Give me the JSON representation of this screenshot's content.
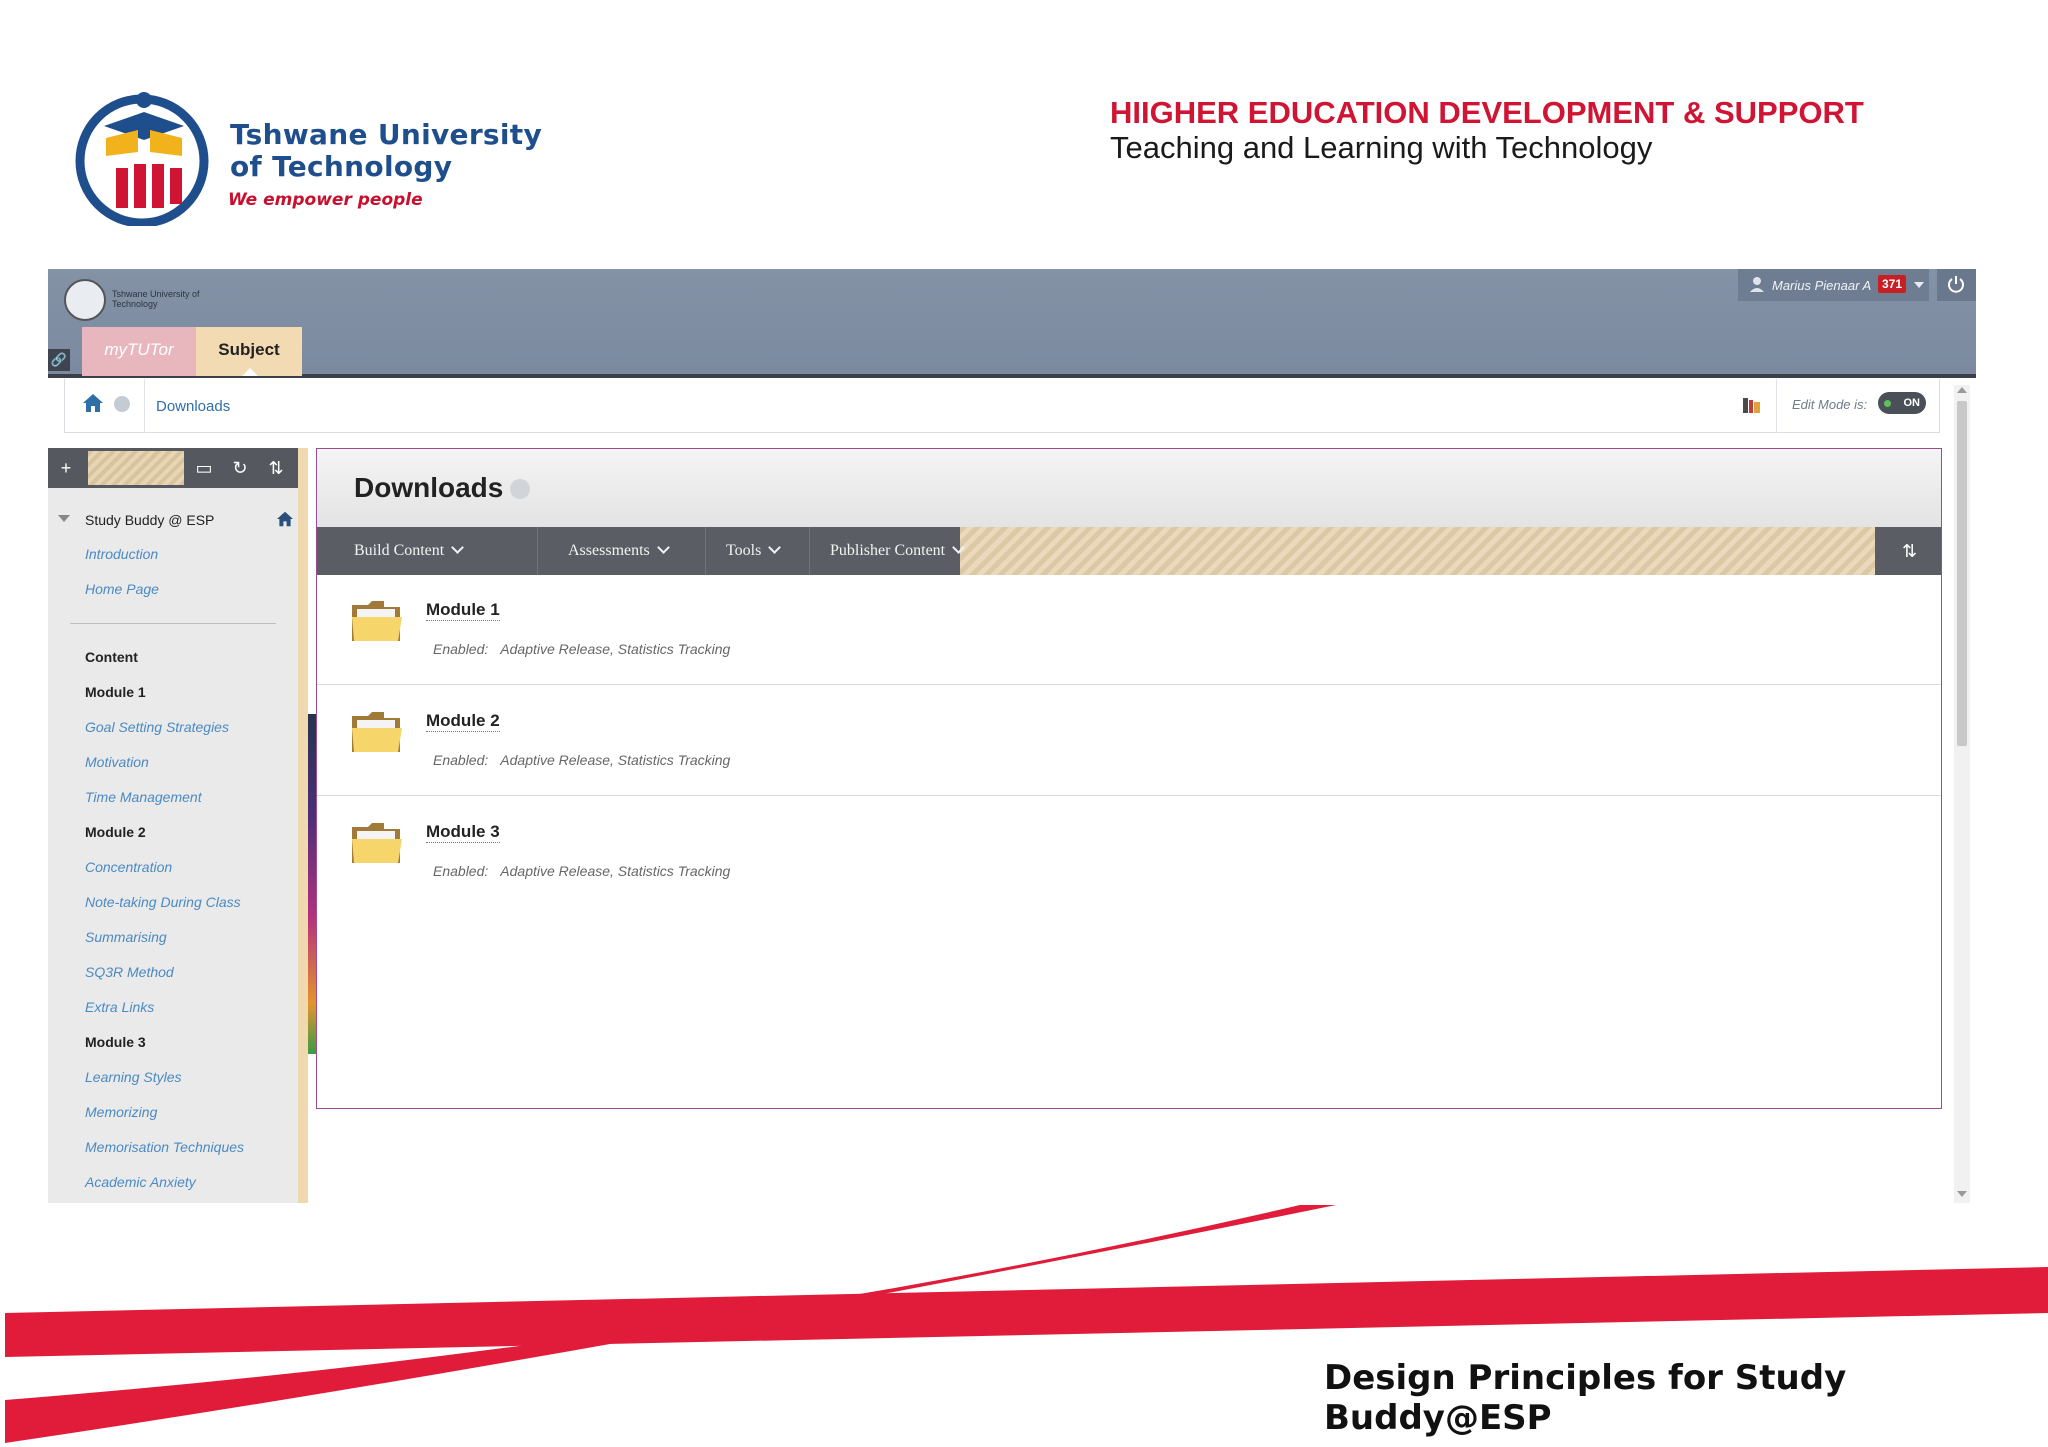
{
  "slide": {
    "university_name_line1": "Tshwane University",
    "university_name_line2": "of Technology",
    "tagline": "We empower people",
    "header_title": "HIIGHER EDUCATION DEVELOPMENT & SUPPORT",
    "header_subtitle": "Teaching and Learning with Technology",
    "footer_title": "Design Principles for Study Buddy@ESP",
    "colors": {
      "brand_red": "#d01433",
      "brand_blue": "#1f4e8c"
    }
  },
  "topbar": {
    "mini_logo_text": "Tshwane University of Technology",
    "tabs": [
      {
        "label": "myTUTor"
      },
      {
        "label": "Subject"
      }
    ],
    "user_name": "Marius Pienaar A",
    "notification_count": "371"
  },
  "breadcrumb": {
    "current": "Downloads",
    "edit_mode_label": "Edit Mode is:",
    "edit_mode_value": "ON"
  },
  "course_menu": {
    "course_title": "Study Buddy @ ESP",
    "items": [
      {
        "label": "Introduction",
        "kind": "link"
      },
      {
        "label": "Home Page",
        "kind": "link"
      },
      {
        "label": "Content",
        "kind": "heading"
      },
      {
        "label": "Module 1",
        "kind": "heading"
      },
      {
        "label": "Goal Setting Strategies",
        "kind": "link"
      },
      {
        "label": "Motivation",
        "kind": "link"
      },
      {
        "label": "Time Management",
        "kind": "link"
      },
      {
        "label": "Module 2",
        "kind": "heading"
      },
      {
        "label": "Concentration",
        "kind": "link"
      },
      {
        "label": "Note-taking During Class",
        "kind": "link"
      },
      {
        "label": "Summarising",
        "kind": "link"
      },
      {
        "label": "SQ3R Method",
        "kind": "link"
      },
      {
        "label": "Extra Links",
        "kind": "link"
      },
      {
        "label": "Module 3",
        "kind": "heading"
      },
      {
        "label": "Learning Styles",
        "kind": "link"
      },
      {
        "label": "Memorizing",
        "kind": "link"
      },
      {
        "label": "Memorisation Techniques",
        "kind": "link"
      },
      {
        "label": "Academic Anxiety",
        "kind": "link"
      }
    ]
  },
  "content": {
    "title": "Downloads",
    "actions": [
      {
        "label": "Build Content"
      },
      {
        "label": "Assessments"
      },
      {
        "label": "Tools"
      },
      {
        "label": "Publisher Content"
      }
    ],
    "items": [
      {
        "title": "Module 1",
        "enabled_label": "Enabled:",
        "enabled_value": "Adaptive Release, Statistics Tracking"
      },
      {
        "title": "Module 2",
        "enabled_label": "Enabled:",
        "enabled_value": "Adaptive Release, Statistics Tracking"
      },
      {
        "title": "Module 3",
        "enabled_label": "Enabled:",
        "enabled_value": "Adaptive Release, Statistics Tracking"
      }
    ]
  }
}
